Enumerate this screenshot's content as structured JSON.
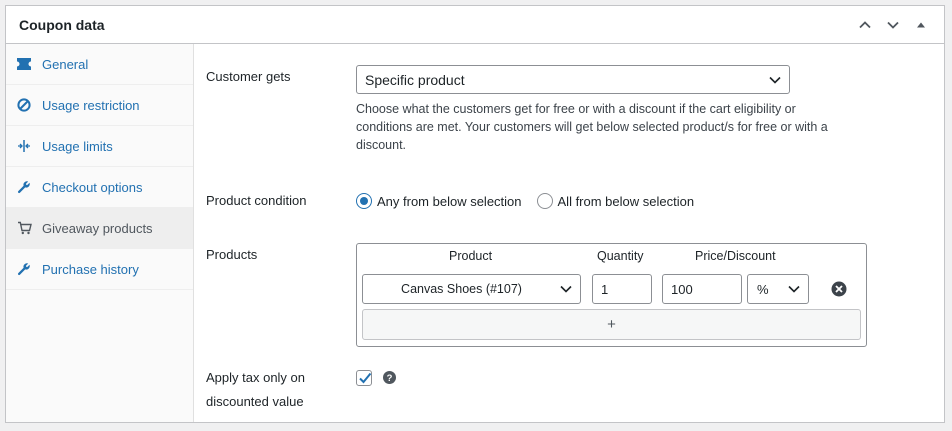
{
  "panel": {
    "title": "Coupon data",
    "header_icons": [
      "chevron-up-icon",
      "chevron-down-icon",
      "triangle-up-icon"
    ]
  },
  "sidebar": {
    "items": [
      {
        "label": "General",
        "icon": "ticket-icon",
        "active": false
      },
      {
        "label": "Usage restriction",
        "icon": "block-icon",
        "active": false
      },
      {
        "label": "Usage limits",
        "icon": "limits-icon",
        "active": false
      },
      {
        "label": "Checkout options",
        "icon": "wrench-icon",
        "active": false
      },
      {
        "label": "Giveaway products",
        "icon": "cart-icon",
        "active": true
      },
      {
        "label": "Purchase history",
        "icon": "wrench-icon",
        "active": false
      }
    ]
  },
  "form": {
    "customer_gets": {
      "label": "Customer gets",
      "value": "Specific product",
      "description": "Choose what the customers get for free or with a discount if the cart eligibility or conditions are met. Your customers will get below selected product/s for free or with a discount."
    },
    "product_condition": {
      "label": "Product condition",
      "options": [
        {
          "label": "Any from below selection",
          "checked": true
        },
        {
          "label": "All from below selection",
          "checked": false
        }
      ]
    },
    "products": {
      "label": "Products",
      "columns": [
        "Product",
        "Quantity",
        "Price/Discount"
      ],
      "rows": [
        {
          "product": "Canvas Shoes (#107)",
          "quantity": "1",
          "price": "100",
          "unit": "%"
        }
      ],
      "add_label": "+"
    },
    "apply_tax": {
      "label_line1": "Apply tax only on",
      "label_line2": "discounted value",
      "checked": true
    }
  },
  "colors": {
    "link": "#2271b1",
    "border": "#8c8f94",
    "active_tab_bg": "#eeeeee"
  }
}
